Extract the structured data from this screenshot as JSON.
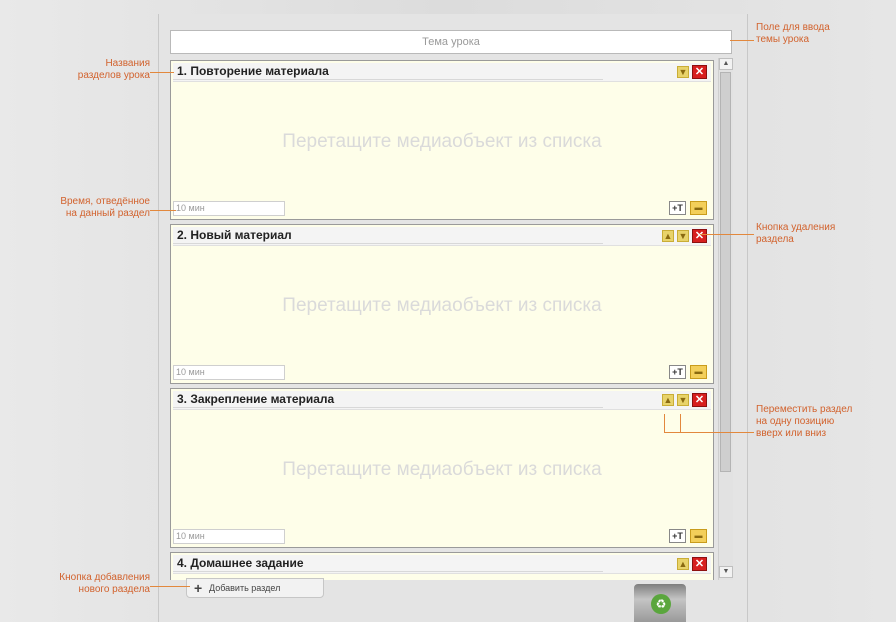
{
  "topic_placeholder": "Тема урока",
  "section_placeholder": "Перетащите медиаобъект из списка",
  "sections": [
    {
      "title": "1.  Повторение материала",
      "time": "10 мин"
    },
    {
      "title": "2.  Новый материал",
      "time": "10 мин"
    },
    {
      "title": "3.  Закрепление материала",
      "time": "10 мин"
    },
    {
      "title": "4.  Домашнее задание",
      "time": ""
    }
  ],
  "add_section_label": "Добавить раздел",
  "annotations": {
    "section_names": "Названия\nразделов урока",
    "time_spent": "Время, отведённое\nна данный раздел",
    "add_section": "Кнопка добавления\nнового раздела",
    "topic_field": "Поле для ввода\nтемы урока",
    "delete_button": "Кнопка удаления\nраздела",
    "move_section": "Переместить раздел\nна одну позицию\nвверх или вниз"
  },
  "icons": {
    "move_up": "arrow-up-icon",
    "move_down": "arrow-down-icon",
    "delete": "close-icon",
    "add_media": "add-object-icon",
    "folder": "folder-icon",
    "trash": "trash-icon",
    "add": "plus-icon"
  },
  "colors": {
    "annotation": "#d2622d",
    "delete_red": "#d71f1f",
    "section_bg": "#fefee9"
  }
}
